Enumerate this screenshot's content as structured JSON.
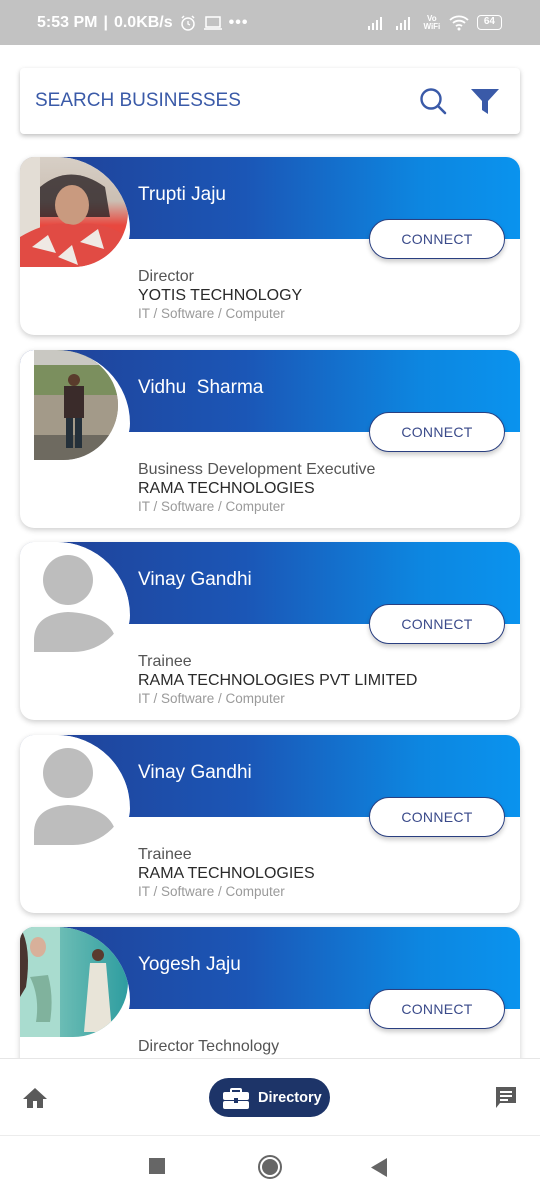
{
  "status_bar": {
    "time": "5:53 PM",
    "network_speed": "0.0KB/s",
    "left_icons": [
      "alarm-icon",
      "laptop-icon",
      "more-dots-icon"
    ],
    "right_icons": [
      "signal-icon",
      "signal-icon",
      "vowifi-icon",
      "wifi-icon",
      "battery-icon"
    ],
    "vowifi_label": "Vo WiFi",
    "battery_level": "64"
  },
  "search": {
    "placeholder": "SEARCH BUSINESSES",
    "value": "",
    "search_icon": "search-icon",
    "filter_icon": "filter-icon"
  },
  "colors": {
    "band_start": "#213f94",
    "band_end": "#0a93ee",
    "accent": "#1d3468",
    "search_text": "#3a5aa8"
  },
  "directory": {
    "connect_label": "CONNECT",
    "entries": [
      {
        "name": "Trupti Jaju",
        "designation": "Director",
        "company": "YOTIS TECHNOLOGY",
        "category": "IT / Software / Computer",
        "avatar": "photo"
      },
      {
        "name": "Vidhu  Sharma",
        "designation": "Business Development Executive",
        "company": "RAMA TECHNOLOGIES",
        "category": "IT / Software / Computer",
        "avatar": "photo"
      },
      {
        "name": "Vinay Gandhi",
        "designation": "Trainee",
        "company": "RAMA TECHNOLOGIES PVT LIMITED",
        "category": "IT / Software / Computer",
        "avatar": "placeholder"
      },
      {
        "name": "Vinay Gandhi",
        "designation": "Trainee",
        "company": "RAMA TECHNOLOGIES",
        "category": "IT / Software / Computer",
        "avatar": "placeholder"
      },
      {
        "name": "Yogesh Jaju",
        "designation": "Director Technology",
        "company": "",
        "category": "",
        "avatar": "photo"
      }
    ]
  },
  "bottom_nav": {
    "items": [
      {
        "icon": "home-icon",
        "label": ""
      },
      {
        "icon": "briefcase-icon",
        "label": "Directory",
        "active": true
      },
      {
        "icon": "chat-icon",
        "label": ""
      }
    ]
  },
  "system_nav": [
    "recents-button",
    "home-button",
    "back-button"
  ]
}
